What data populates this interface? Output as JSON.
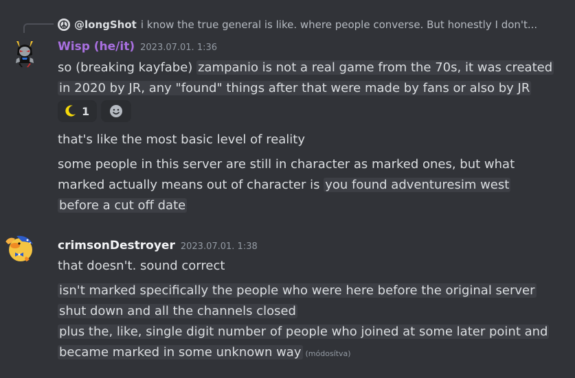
{
  "reply": {
    "username": "@longShot",
    "preview": "i know the true general is like. where people converse. But honestly I don't..."
  },
  "messages": [
    {
      "username": "Wisp (he/it)",
      "username_color": "#a970e0",
      "timestamp": "2023.07.01. 1:36",
      "avatar_icon": "character-avatar",
      "lines": [
        {
          "plain": "so (breaking kayfabe) ",
          "highlight": "zampanio is not a real game from the 70s, it was created"
        },
        {
          "highlight": "in 2020 by JR, any \"found\" things after that were made by fans or also by JR"
        }
      ],
      "reactions": [
        {
          "icon": "crescent-moon-icon",
          "count": "1"
        },
        {
          "icon": "add-reaction-icon"
        }
      ],
      "followups": [
        "that's like the most basic level of reality",
        "some people in this server are still in character as marked ones, but what"
      ],
      "followup_mixed": {
        "plain": "marked actually means out of character is ",
        "highlight": "you found adventuresim west"
      },
      "followup_last": "before a cut off date"
    },
    {
      "username": "crimsonDestroyer",
      "username_color": "#f2f3f5",
      "timestamp": "2023.07.01. 1:38",
      "avatar_icon": "duck-avatar",
      "lines": [
        "that doesn't. sound correct",
        "isn't marked specifically the people who were here before the original server",
        "shut down and all the channels closed",
        "plus the, like, single digit number of people who joined at some later point and",
        "became marked in some unknown way"
      ],
      "edited": "(módosítva)"
    }
  ]
}
